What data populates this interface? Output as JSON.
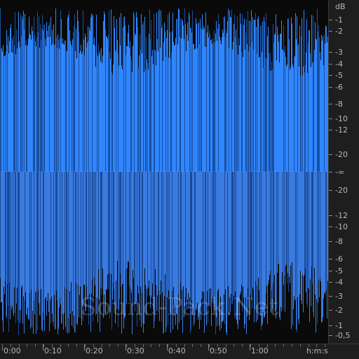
{
  "colors": {
    "waveform_top": "#2f86ff",
    "waveform_bottom": "#3a7be0",
    "background": "#0a0a0a",
    "ruler_bg": "#1e1e1e",
    "ruler_text": "#b8b8b8"
  },
  "db_ruler": {
    "unit": "dB",
    "labels": [
      "-1",
      "-2",
      "-3",
      "-4",
      "-5",
      "-6",
      "-8",
      "-10",
      "-12",
      "-20",
      "-∞",
      "-20",
      "-12",
      "-10",
      "-8",
      "-6",
      "-5",
      "-4",
      "-3",
      "-2",
      "-1",
      "-0,5"
    ]
  },
  "time_ruler": {
    "labels": [
      "0:00",
      "0:10",
      "0:20",
      "0:30",
      "0:40",
      "0:50",
      "1:00"
    ],
    "unit": "h:m:s"
  },
  "watermark": "Sound-Pack.Net"
}
